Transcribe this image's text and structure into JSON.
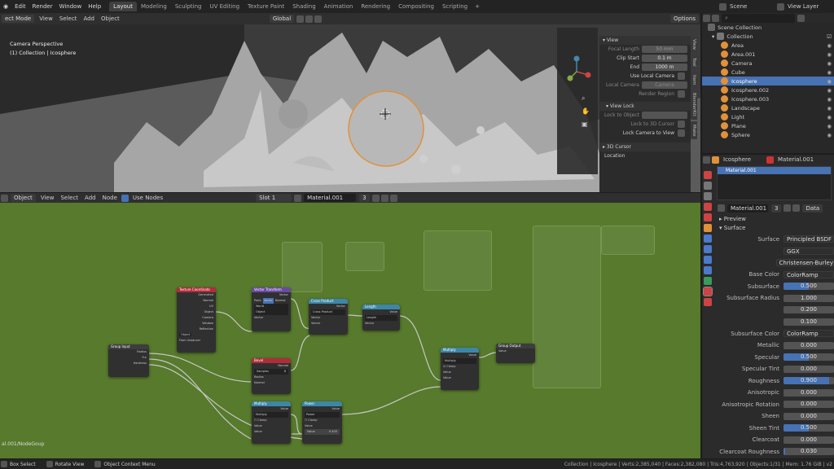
{
  "menu": {
    "items": [
      "Edit",
      "Render",
      "Window",
      "Help"
    ]
  },
  "workspaces": [
    "Layout",
    "Modeling",
    "Sculpting",
    "UV Editing",
    "Texture Paint",
    "Shading",
    "Animation",
    "Rendering",
    "Compositing",
    "Scripting"
  ],
  "active_workspace": "Layout",
  "scene": {
    "name": "Scene",
    "view_layer": "View Layer"
  },
  "viewport": {
    "mode": "ect Mode",
    "menus": [
      "View",
      "Select",
      "Add",
      "Object"
    ],
    "orientation": "Global",
    "options_label": "Options",
    "overlay_title": "Camera Perspective",
    "overlay_subtitle": "(1) Collection | Icosphere"
  },
  "npanel": {
    "view_title": "View",
    "focal_length_label": "Focal Length",
    "focal_length": "50 mm",
    "clip_start_label": "Clip Start",
    "clip_start": "0.1 m",
    "end_label": "End",
    "end": "1000 m",
    "use_local_camera": "Use Local Camera",
    "local_camera_label": "Local Camera",
    "local_camera": "Camera",
    "render_region": "Render Region",
    "view_lock_title": "View Lock",
    "lock_to_object": "Lock to Object",
    "lock_to_3d_cursor": "Lock to 3D Cursor",
    "lock_camera_to_view": "Lock Camera to View",
    "cursor_title": "3D Cursor",
    "location_label": "Location",
    "tabs": [
      "View",
      "Tool",
      "Item",
      "BlenderKit",
      "Make"
    ]
  },
  "node_editor": {
    "header": {
      "object": "Object",
      "menus": [
        "View",
        "Select",
        "Add",
        "Node"
      ],
      "use_nodes": "Use Nodes",
      "slot": "Slot 1",
      "material": "Material.001",
      "users": "3"
    },
    "breadcrumb": "al.001/NodeGoup",
    "nodes": {
      "group_input": {
        "title": "Group Input",
        "outputs": [
          "Radius",
          "Fur",
          "Hardness"
        ]
      },
      "tex_coord": {
        "title": "Texture Coordinate",
        "outputs": [
          "Generated",
          "Normal",
          "UV",
          "Object",
          "Camera",
          "Window",
          "Reflection"
        ],
        "object": "Object",
        "from_instancer": "From Instancer"
      },
      "vector_transform": {
        "title": "Vector Transform",
        "out": "Vector",
        "types": [
          "Point",
          "Vector",
          "Normal"
        ],
        "from": "World",
        "to": "Object",
        "in": "Vector"
      },
      "cross_product": {
        "title": "Cross Product",
        "out": "Vector",
        "op": "Cross Product",
        "inputs": [
          "Vector",
          "Vector"
        ]
      },
      "length": {
        "title": "Length",
        "out": "Value",
        "op": "Length",
        "in": "Vector"
      },
      "bevel": {
        "title": "Bevel",
        "out": "Normal",
        "samples_label": "Samples",
        "samples": "8",
        "inputs": [
          "Radius",
          "Normal"
        ]
      },
      "multiply1": {
        "title": "Multiply",
        "out": "Value",
        "op": "Multiply",
        "clamp": "Clamp",
        "inputs": [
          "Value",
          "Value"
        ]
      },
      "power": {
        "title": "Power",
        "out": "Value",
        "op": "Power",
        "clamp": "Clamp",
        "inputs": [
          "Value",
          "Value"
        ],
        "v2": "0.400"
      },
      "multiply2": {
        "title": "Multiply",
        "out": "Value",
        "op": "Multiply",
        "clamp": "Clamp",
        "inputs": [
          "Value",
          "Value"
        ]
      },
      "group_output": {
        "title": "Group Output",
        "inputs": [
          "Value"
        ]
      }
    }
  },
  "outliner": {
    "root": "Scene Collection",
    "collection": "Collection",
    "items": [
      {
        "name": "Area",
        "color": "#e0913a"
      },
      {
        "name": "Area.001",
        "color": "#e0913a"
      },
      {
        "name": "Camera",
        "color": "#e0913a"
      },
      {
        "name": "Cube",
        "color": "#e0913a"
      },
      {
        "name": "Icosphere",
        "color": "#e0913a",
        "selected": true
      },
      {
        "name": "Icosphere.002",
        "color": "#e0913a"
      },
      {
        "name": "Icosphere.003",
        "color": "#e0913a"
      },
      {
        "name": "Landscape",
        "color": "#e0913a"
      },
      {
        "name": "Light",
        "color": "#e0913a"
      },
      {
        "name": "Plane",
        "color": "#e0913a"
      },
      {
        "name": "Sphere",
        "color": "#e0913a"
      }
    ]
  },
  "properties": {
    "object": "Icosphere",
    "material_name": "Material.001",
    "slot_material": "Material.001",
    "users": "3",
    "data_label": "Data",
    "preview": "Preview",
    "surface": "Surface",
    "rows": [
      {
        "label": "Surface",
        "value": "Principled BSDF",
        "type": "text"
      },
      {
        "label": "",
        "value": "GGX",
        "type": "text"
      },
      {
        "label": "",
        "value": "Christensen-Burley",
        "type": "text"
      },
      {
        "label": "Base Color",
        "value": "ColorRamp",
        "type": "text"
      },
      {
        "label": "Subsurface",
        "value": "0.500",
        "type": "blue"
      },
      {
        "label": "Subsurface Radius",
        "value": "1.000",
        "type": "num"
      },
      {
        "label": "",
        "value": "0.200",
        "type": "num"
      },
      {
        "label": "",
        "value": "0.100",
        "type": "num"
      },
      {
        "label": "Subsurface Color",
        "value": "ColorRamp",
        "type": "text"
      },
      {
        "label": "Metallic",
        "value": "0.000",
        "type": "num"
      },
      {
        "label": "Specular",
        "value": "0.500",
        "type": "blue"
      },
      {
        "label": "Specular Tint",
        "value": "0.000",
        "type": "num"
      },
      {
        "label": "Roughness",
        "value": "0.900",
        "type": "blue"
      },
      {
        "label": "Anisotropic",
        "value": "0.000",
        "type": "num"
      },
      {
        "label": "Anisotropic Rotation",
        "value": "0.000",
        "type": "num"
      },
      {
        "label": "Sheen",
        "value": "0.000",
        "type": "num"
      },
      {
        "label": "Sheen Tint",
        "value": "0.500",
        "type": "blue"
      },
      {
        "label": "Clearcoat",
        "value": "0.000",
        "type": "num"
      },
      {
        "label": "Clearcoat Roughness",
        "value": "0.030",
        "type": "blue"
      }
    ]
  },
  "statusbar": {
    "select": "Box Select",
    "rotate": "Rotate View",
    "context": "Object Context Menu",
    "stats": "Collection | Icosphere | Verts:2,385,040 | Faces:2,382,080 | Tris:4,763,920 | Objects:1/31 | Mem: 1.76 GiB | v2"
  },
  "colors": {
    "accent": "#4772b3",
    "node_bg": "#577a2c",
    "selection": "#e0913a"
  }
}
